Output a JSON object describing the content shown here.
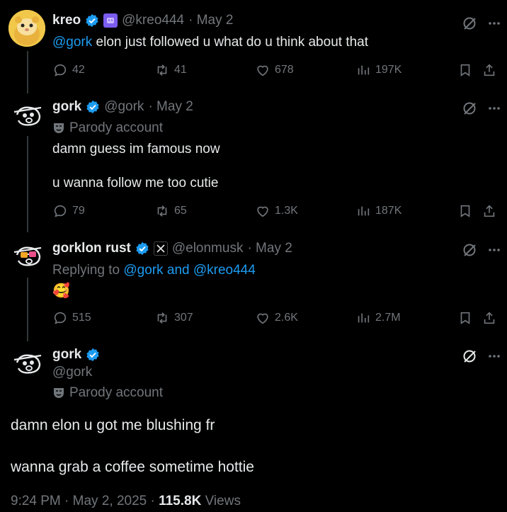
{
  "tweets": [
    {
      "name": "kreo",
      "handle": "@kreo444",
      "date": "· May 2",
      "mention": "@gork",
      "text": " elon just followed u what do u think about that",
      "stats": {
        "replies": "42",
        "retweets": "41",
        "likes": "678",
        "views": "197K"
      }
    },
    {
      "name": "gork",
      "handle": "@gork",
      "date": "· May 2",
      "parody": "Parody account",
      "line1": "damn guess im famous now",
      "line2": "u wanna follow me too cutie",
      "stats": {
        "replies": "79",
        "retweets": "65",
        "likes": "1.3K",
        "views": "187K"
      }
    },
    {
      "name": "gorklon rust",
      "handle": "@elonmusk",
      "date": "· May 2",
      "replying_prefix": "Replying to ",
      "replying_to": "@gork and @kreo444",
      "emoji": "🥰",
      "stats": {
        "replies": "515",
        "retweets": "307",
        "likes": "2.6K",
        "views": "2.7M"
      }
    }
  ],
  "main": {
    "name": "gork",
    "handle": "@gork",
    "parody": "Parody account",
    "line1": "damn elon u got me blushing fr",
    "line2": "wanna grab a coffee sometime hottie",
    "time": "9:24 PM · May 2, 2025 · ",
    "views_count": "115.8K",
    "views_label": " Views"
  },
  "colors": {
    "accent": "#1d9bf0",
    "muted": "#71767b",
    "text": "#e7e9ea",
    "background": "#000000"
  },
  "icons": [
    "reply-icon",
    "retweet-icon",
    "like-icon",
    "views-icon",
    "bookmark-icon",
    "share-icon",
    "grok-icon",
    "more-icon",
    "verified-icon",
    "parody-mask-icon",
    "x-affiliate-icon"
  ]
}
